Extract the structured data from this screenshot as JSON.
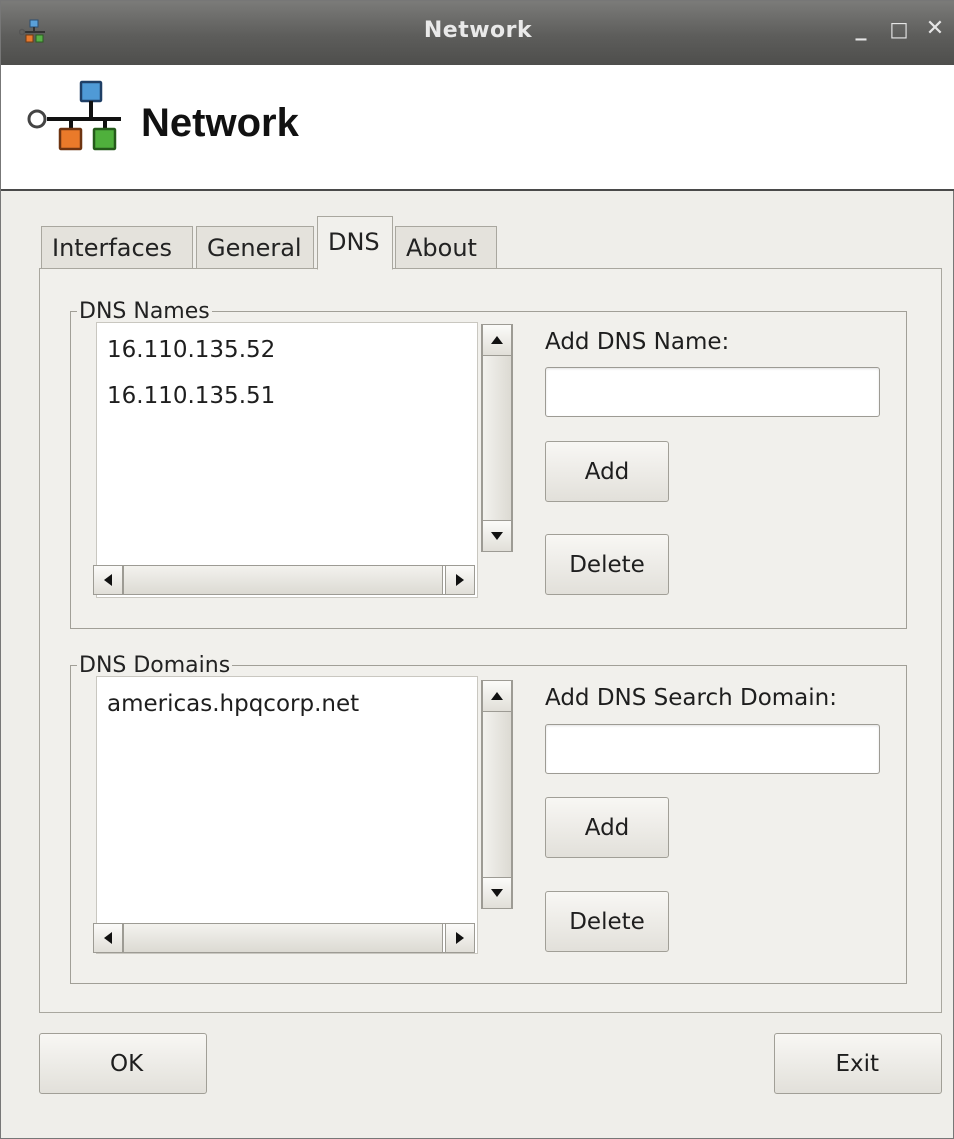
{
  "window": {
    "title": "Network",
    "heading": "Network",
    "controls": {
      "minimize": "_",
      "maximize": "□",
      "close": "✕"
    }
  },
  "tabs": [
    {
      "label": "Interfaces",
      "active": false
    },
    {
      "label": "General",
      "active": false
    },
    {
      "label": "DNS",
      "active": true
    },
    {
      "label": "About",
      "active": false
    }
  ],
  "dns_names": {
    "legend": "DNS Names",
    "items": [
      "16.110.135.52",
      "16.110.135.51"
    ],
    "add_label": "Add DNS Name:",
    "input_value": "",
    "add_button": "Add",
    "delete_button": "Delete"
  },
  "dns_domains": {
    "legend": "DNS Domains",
    "items": [
      "americas.hpqcorp.net"
    ],
    "add_label": "Add DNS Search Domain:",
    "input_value": "",
    "add_button": "Add",
    "delete_button": "Delete"
  },
  "footer": {
    "ok_button": "OK",
    "exit_button": "Exit"
  },
  "icons": {
    "app": "network-icon",
    "scroll_up": "arrow-up-icon",
    "scroll_down": "arrow-down-icon",
    "scroll_left": "arrow-left-icon",
    "scroll_right": "arrow-right-icon"
  }
}
